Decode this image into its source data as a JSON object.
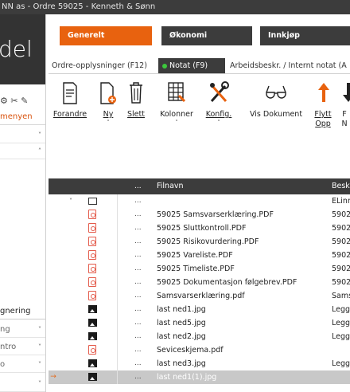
{
  "window": {
    "title": "NN as - Ordre 59025 - Kenneth & Sønn"
  },
  "sidebar": {
    "logo_text": "del",
    "icon_glyphs": "⚙ ✂ ✎",
    "title": "menyen",
    "rows": [
      {
        "label": "",
        "chevron": "˅"
      },
      {
        "label": "",
        "chevron": "˄"
      },
      {
        "label": "gnering",
        "chevron": ""
      },
      {
        "label": "ng",
        "chevron": "˅"
      },
      {
        "label": "ntro",
        "chevron": "˅"
      },
      {
        "label": "o",
        "chevron": "˅"
      },
      {
        "label": "",
        "chevron": "˅"
      }
    ]
  },
  "header": {
    "buttons": [
      {
        "label": "Generelt",
        "color": "#e8620f"
      },
      {
        "label": "Økonomi",
        "color": "#3c3c3c"
      },
      {
        "label": "Innkjøp",
        "color": "#3c3c3c"
      }
    ]
  },
  "tabs": [
    {
      "label": "Ordre-opplysninger (F12)"
    },
    {
      "label": "Notat (F9)",
      "active": true
    },
    {
      "label": "Arbeidsbeskr. / Internt notat (A"
    }
  ],
  "toolbar": {
    "buttons": [
      {
        "label": "Forandre",
        "icon": "document-edit-icon",
        "underline": "F"
      },
      {
        "label": "Ny",
        "icon": "new-document-icon",
        "caret": "˅"
      },
      {
        "label": "Slett",
        "icon": "trash-icon"
      },
      {
        "label": "Kolonner",
        "icon": "columns-icon",
        "caret": "˅"
      },
      {
        "label": "Konfig.",
        "icon": "tools-icon",
        "caret": "˅"
      },
      {
        "label": "Vis Dokument",
        "icon": "glasses-icon"
      },
      {
        "label": "Flytt Opp",
        "icon": "arrow-up-icon"
      },
      {
        "label": "F N",
        "icon": "arrow-down-icon"
      }
    ]
  },
  "grid": {
    "header": {
      "dots": "...",
      "name": "Filnavn",
      "desc": "Besk"
    },
    "rows": [
      {
        "type": "folder",
        "tree": "˅",
        "dots": "...",
        "name": "",
        "desc": "ELinn"
      },
      {
        "type": "pdf",
        "dots": "...",
        "name": "59025 Samsvarserklæring.PDF",
        "desc": "5902"
      },
      {
        "type": "pdf",
        "dots": "...",
        "name": "59025 Sluttkontroll.PDF",
        "desc": "5902"
      },
      {
        "type": "pdf",
        "dots": "...",
        "name": "59025 Risikovurdering.PDF",
        "desc": "5902"
      },
      {
        "type": "pdf",
        "dots": "...",
        "name": "59025 Vareliste.PDF",
        "desc": "5902"
      },
      {
        "type": "pdf",
        "dots": "...",
        "name": "59025 Timeliste.PDF",
        "desc": "5902"
      },
      {
        "type": "pdf",
        "dots": "...",
        "name": "59025 Dokumentasjon følgebrev.PDF",
        "desc": "5902"
      },
      {
        "type": "pdf",
        "dots": "...",
        "name": "Samsvarserklæring.pdf",
        "desc": "Sams"
      },
      {
        "type": "image",
        "dots": "...",
        "name": "last ned1.jpg",
        "desc": "Legg"
      },
      {
        "type": "image",
        "dots": "...",
        "name": "last ned5.jpg",
        "desc": "Legg"
      },
      {
        "type": "image",
        "dots": "...",
        "name": "last ned2.jpg",
        "desc": "Legg"
      },
      {
        "type": "pdf",
        "dots": "...",
        "name": "Seviceskjema.pdf",
        "desc": ""
      },
      {
        "type": "image",
        "dots": "...",
        "name": "last ned3.jpg",
        "desc": "Legg"
      },
      {
        "type": "image",
        "dots": "...",
        "name": "last ned1(1).jpg",
        "desc": "",
        "selected": true,
        "arrow": "→"
      }
    ]
  }
}
